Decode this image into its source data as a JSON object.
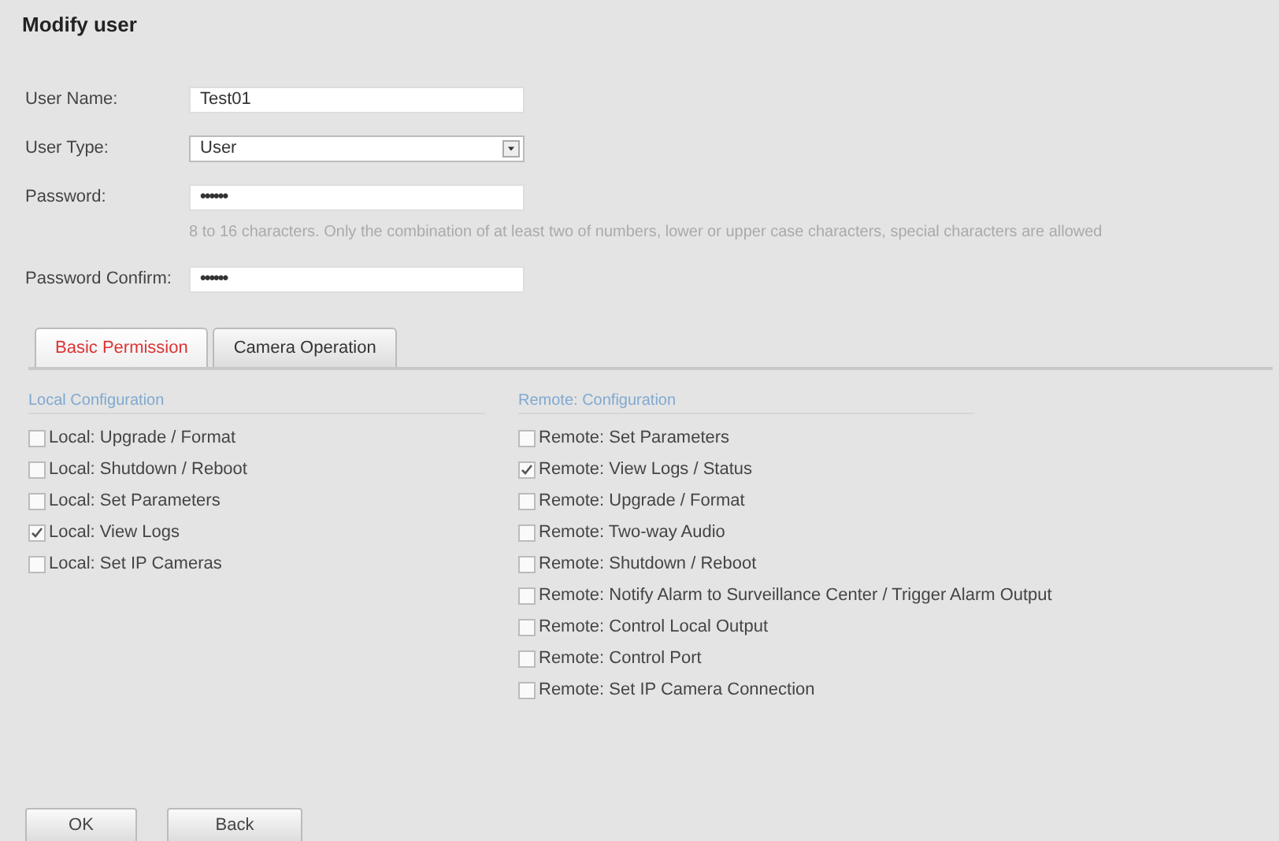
{
  "title": "Modify user",
  "fields": [
    {
      "kind": "text",
      "label": "User Name:",
      "value": "Test01"
    },
    {
      "kind": "select",
      "label": "User Type:",
      "value": "User"
    },
    {
      "kind": "password",
      "label": "Password:",
      "value": "••••••",
      "hint": "8 to 16 characters. Only the combination of at least two of numbers, lower or upper case characters, special characters are allowed"
    },
    {
      "kind": "password",
      "label": "Password Confirm:",
      "value": "••••••"
    }
  ],
  "tabs": [
    {
      "label": "Basic Permission",
      "selected": true
    },
    {
      "label": "Camera Operation",
      "selected": false
    }
  ],
  "groups": [
    {
      "title": "Local Configuration",
      "items": [
        {
          "label": "Local: Upgrade / Format",
          "checked": false
        },
        {
          "label": "Local: Shutdown / Reboot",
          "checked": false
        },
        {
          "label": "Local: Set Parameters",
          "checked": false
        },
        {
          "label": "Local: View Logs",
          "checked": true
        },
        {
          "label": "Local: Set IP Cameras",
          "checked": false
        }
      ]
    },
    {
      "title": "Remote: Configuration",
      "items": [
        {
          "label": "Remote: Set Parameters",
          "checked": false
        },
        {
          "label": "Remote: View Logs / Status",
          "checked": true
        },
        {
          "label": "Remote: Upgrade / Format",
          "checked": false
        },
        {
          "label": "Remote: Two-way Audio",
          "checked": false
        },
        {
          "label": "Remote: Shutdown / Reboot",
          "checked": false
        },
        {
          "label": "Remote: Notify Alarm to Surveillance Center / Trigger Alarm Output",
          "checked": false
        },
        {
          "label": "Remote: Control Local Output",
          "checked": false
        },
        {
          "label": "Remote: Control Port",
          "checked": false
        },
        {
          "label": "Remote: Set IP Camera Connection",
          "checked": false
        }
      ]
    }
  ],
  "buttons": [
    "OK",
    "Back"
  ]
}
